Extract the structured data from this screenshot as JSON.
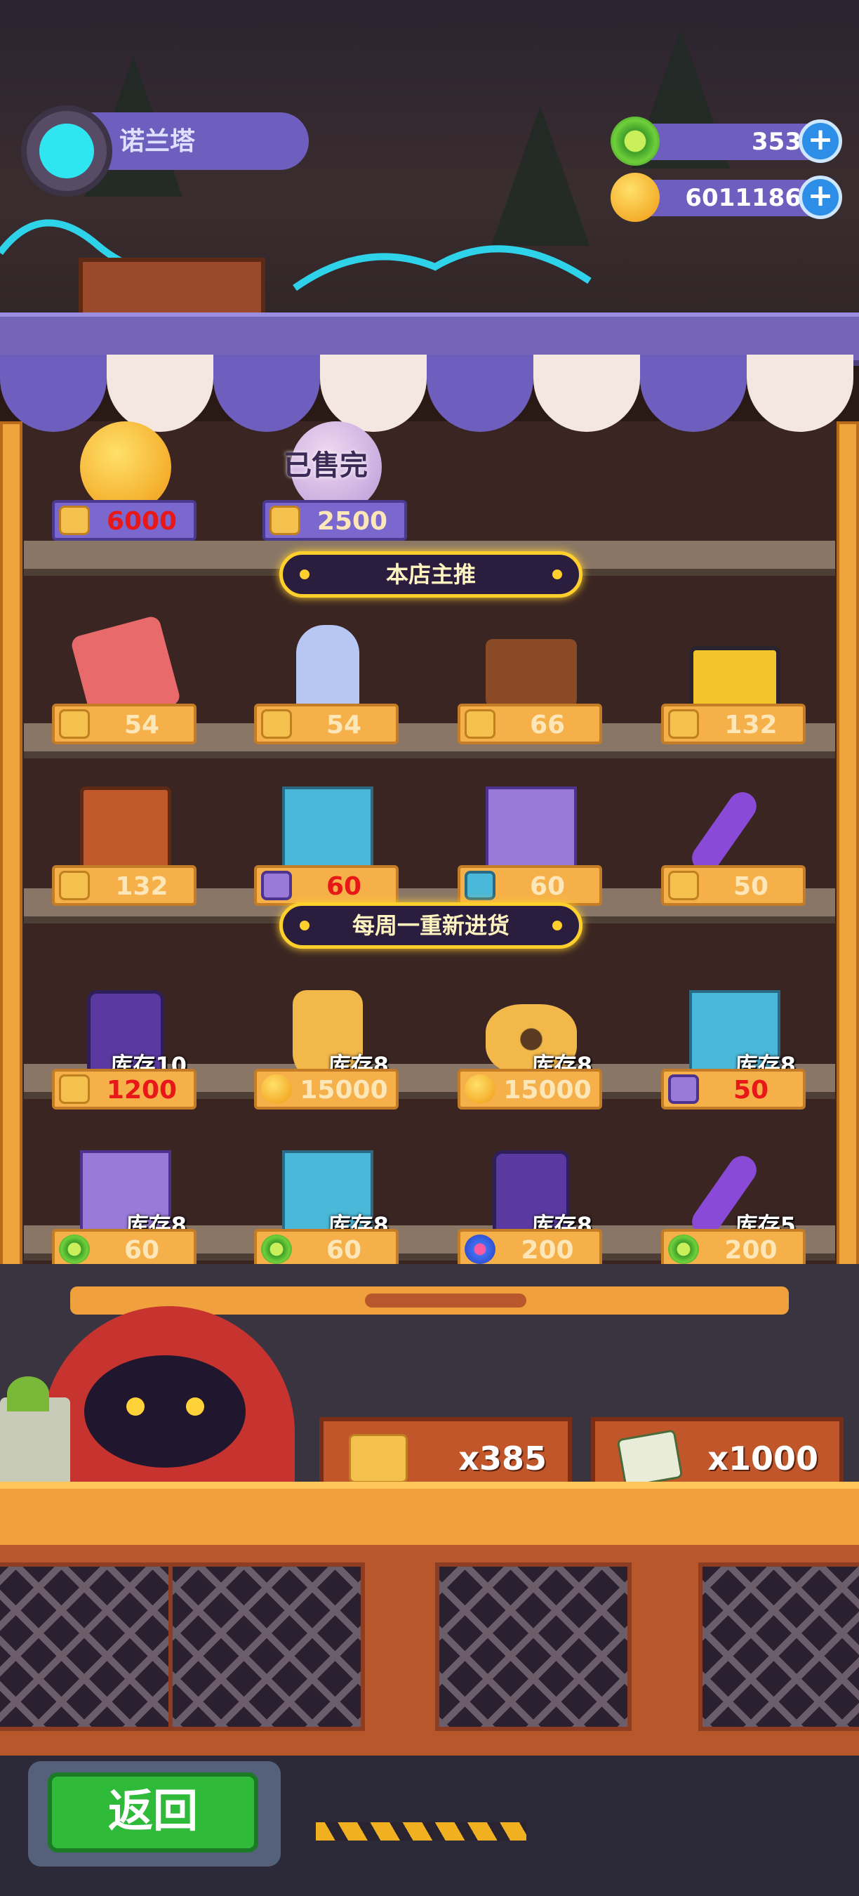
{
  "header": {
    "player_name": "诺兰塔",
    "currencies": [
      {
        "name": "green-gem",
        "value": "353",
        "icon": "green-donut-icon",
        "color": "#6fcf3a"
      },
      {
        "name": "gold-coin",
        "value": "6011186",
        "icon": "gold-coin-icon",
        "color": "#f7b52a"
      }
    ],
    "plus_label": "+"
  },
  "shop": {
    "top_row": [
      {
        "icon": "golden-egg-bundle-icon",
        "currency": "ticket-icon",
        "price": "6000",
        "price_color": "red",
        "sold_label": ""
      },
      {
        "icon": "purple-egg-bundle-icon",
        "currency": "ticket-icon",
        "price": "2500",
        "price_color": "normal",
        "sold_label": "已售完"
      }
    ],
    "section_featured": "本店主推",
    "featured_row1": [
      {
        "icon": "scroll-bundle-icon",
        "currency": "ticket-icon",
        "price": "54"
      },
      {
        "icon": "potion-bottle-icon",
        "currency": "ticket-icon",
        "price": "54"
      },
      {
        "icon": "handbag-icon",
        "currency": "ticket-icon",
        "price": "66"
      },
      {
        "icon": "toolbox-icon",
        "currency": "ticket-icon",
        "price": "132"
      }
    ],
    "featured_row2": [
      {
        "icon": "wooden-crate-icon",
        "currency": "ticket-icon",
        "price": "132",
        "price_color": "normal"
      },
      {
        "icon": "blue-house-box-icon",
        "currency": "purple-refresh-icon",
        "price": "60",
        "price_color": "red"
      },
      {
        "icon": "purple-refresh-box-icon",
        "currency": "blue-house-icon",
        "price": "60",
        "price_color": "normal"
      },
      {
        "icon": "screwdriver-icon",
        "currency": "ticket-icon",
        "price": "50",
        "price_color": "normal"
      }
    ],
    "section_weekly": "每周一重新进货",
    "weekly_row1": [
      {
        "icon": "purple-phone-icon",
        "stock": "库存10",
        "currency": "ticket-icon",
        "price": "1200",
        "price_color": "red"
      },
      {
        "icon": "golden-bolt-icon",
        "stock": "库存8",
        "currency": "gold-coin-icon",
        "price": "15000",
        "price_color": "normal"
      },
      {
        "icon": "golden-nut-icon",
        "stock": "库存8",
        "currency": "gold-coin-icon",
        "price": "15000",
        "price_color": "normal"
      },
      {
        "icon": "blue-house-box-icon",
        "stock": "库存8",
        "currency": "purple-refresh-icon",
        "price": "50",
        "price_color": "red"
      }
    ],
    "weekly_row2": [
      {
        "icon": "purple-refresh-box-icon",
        "stock": "库存8",
        "currency": "green-donut-icon",
        "price": "60"
      },
      {
        "icon": "blue-house-box-icon",
        "stock": "库存8",
        "currency": "green-donut-icon",
        "price": "60"
      },
      {
        "icon": "purple-phone-icon",
        "stock": "库存8",
        "currency": "blue-gem-icon",
        "price": "200"
      },
      {
        "icon": "screwdriver-icon",
        "stock": "库存5",
        "currency": "green-donut-icon",
        "price": "200"
      }
    ]
  },
  "counter": {
    "bins": [
      {
        "icon": "ticket-icon",
        "count": "x385"
      },
      {
        "icon": "seed-packet-icon",
        "count": "x1000"
      }
    ]
  },
  "footer": {
    "back_label": "返回"
  },
  "colors": {
    "accent": "#ffcf2e",
    "price_red": "#e81818",
    "panel": "#6e5fbf",
    "button_green": "#2fba3a"
  }
}
